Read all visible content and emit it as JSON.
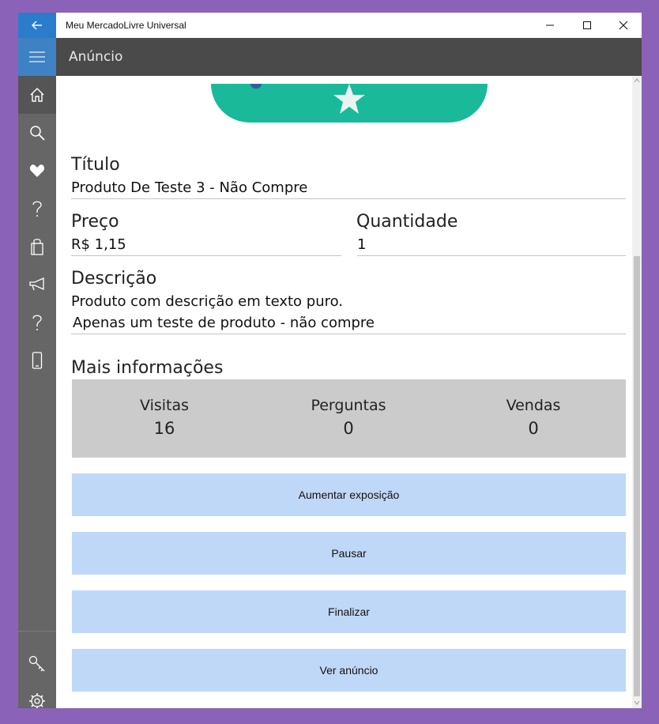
{
  "window": {
    "title": "Meu MercadoLivre Universal",
    "page_title": "Anúncio"
  },
  "icons": {
    "back": "back-arrow-icon",
    "menu": "hamburger-icon",
    "minimize": "minimize-icon",
    "maximize": "maximize-icon",
    "close": "close-icon"
  },
  "sidebar": {
    "items": [
      {
        "name": "home",
        "icon": "home-icon",
        "active": true
      },
      {
        "name": "search",
        "icon": "search-icon",
        "active": false
      },
      {
        "name": "favorites",
        "icon": "heart-icon",
        "active": false
      },
      {
        "name": "questions",
        "icon": "question-icon",
        "active": false
      },
      {
        "name": "purchases",
        "icon": "shopping-bag-icon",
        "active": false
      },
      {
        "name": "announcements",
        "icon": "megaphone-icon",
        "active": false
      },
      {
        "name": "help",
        "icon": "question-icon",
        "active": false
      },
      {
        "name": "device",
        "icon": "phone-icon",
        "active": false
      }
    ],
    "bottom_items": [
      {
        "name": "account",
        "icon": "key-icon"
      },
      {
        "name": "settings",
        "icon": "gear-icon"
      }
    ]
  },
  "listing": {
    "title_label": "Título",
    "title_value": "Produto De Teste 3 - Não Compre",
    "price_label": "Preço",
    "price_value": "R$ 1,15",
    "quantity_label": "Quantidade",
    "quantity_value": "1",
    "description_label": "Descrição",
    "description_line1": "Produto com descrição em texto puro.",
    "description_line2": "Apenas um teste de produto - não compre"
  },
  "more_info": {
    "heading": "Mais informações",
    "stats": [
      {
        "label": "Visitas",
        "value": "16"
      },
      {
        "label": "Perguntas",
        "value": "0"
      },
      {
        "label": "Vendas",
        "value": "0"
      }
    ]
  },
  "actions": {
    "boost": "Aumentar exposição",
    "pause": "Pausar",
    "finish": "Finalizar",
    "view": "Ver anúncio"
  },
  "colors": {
    "accent": "#2b7ccb",
    "header": "#4a4a4a",
    "sidebar": "#666666",
    "button": "#c0d8f8",
    "stats_bg": "#cbcbcb",
    "banner": "#19b99a"
  }
}
